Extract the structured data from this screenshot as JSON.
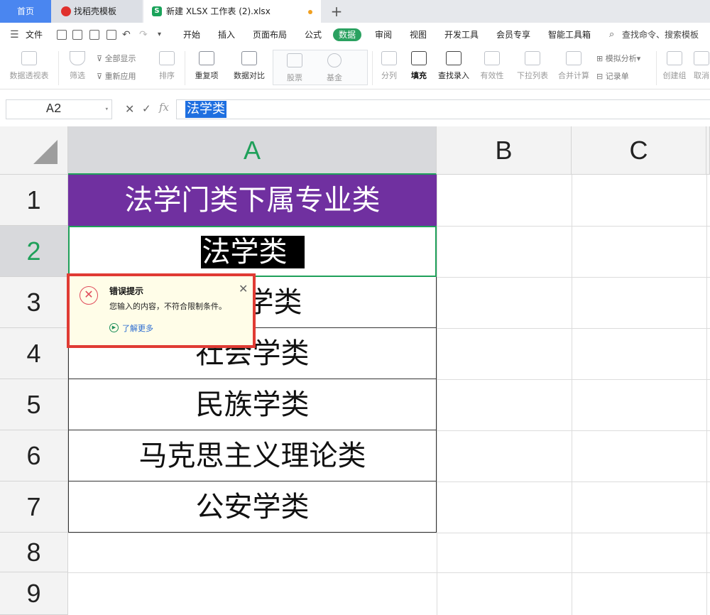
{
  "tabs": {
    "home": "首页",
    "template": "找稻壳模板",
    "file": "新建 XLSX 工作表 (2).xlsx",
    "file_icon": "S"
  },
  "menu": {
    "file": "文件",
    "items": [
      "开始",
      "插入",
      "页面布局",
      "公式",
      "数据",
      "审阅",
      "视图",
      "开发工具",
      "会员专享",
      "智能工具箱"
    ],
    "active": "数据",
    "search": "查找命令、搜索模板"
  },
  "ribbon": {
    "pivot": "数据透视表",
    "filter": "筛选",
    "show_all": "全部显示",
    "reapply": "重新应用",
    "sort": "排序",
    "duplicates": "重复项",
    "compare": "数据对比",
    "stock": "股票",
    "fund": "基金",
    "split": "分列",
    "fill": "填充",
    "lookup": "查找录入",
    "validity": "有效性",
    "dropdown": "下拉列表",
    "consolidate": "合并计算",
    "simulate": "模拟分析",
    "record": "记录单",
    "group": "创建组",
    "ungroup": "取消"
  },
  "formula_bar": {
    "name_box": "A2",
    "fx": "fx",
    "value": "法学类"
  },
  "columns": [
    "A",
    "B",
    "C"
  ],
  "selected_column": "A",
  "rows": [
    "1",
    "2",
    "3",
    "4",
    "5",
    "6",
    "7",
    "8",
    "9"
  ],
  "selected_row": "2",
  "cells": {
    "a1": "法学门类下属专业类",
    "a2": "法学类",
    "a3": "学类",
    "a4": "社会学类",
    "a5": "民族学类",
    "a6": "马克思主义理论类",
    "a7": "公安学类"
  },
  "header_fill": "#7030a0",
  "error_popup": {
    "title": "错误提示",
    "message": "您输入的内容，不符合限制条件。",
    "more": "了解更多"
  }
}
